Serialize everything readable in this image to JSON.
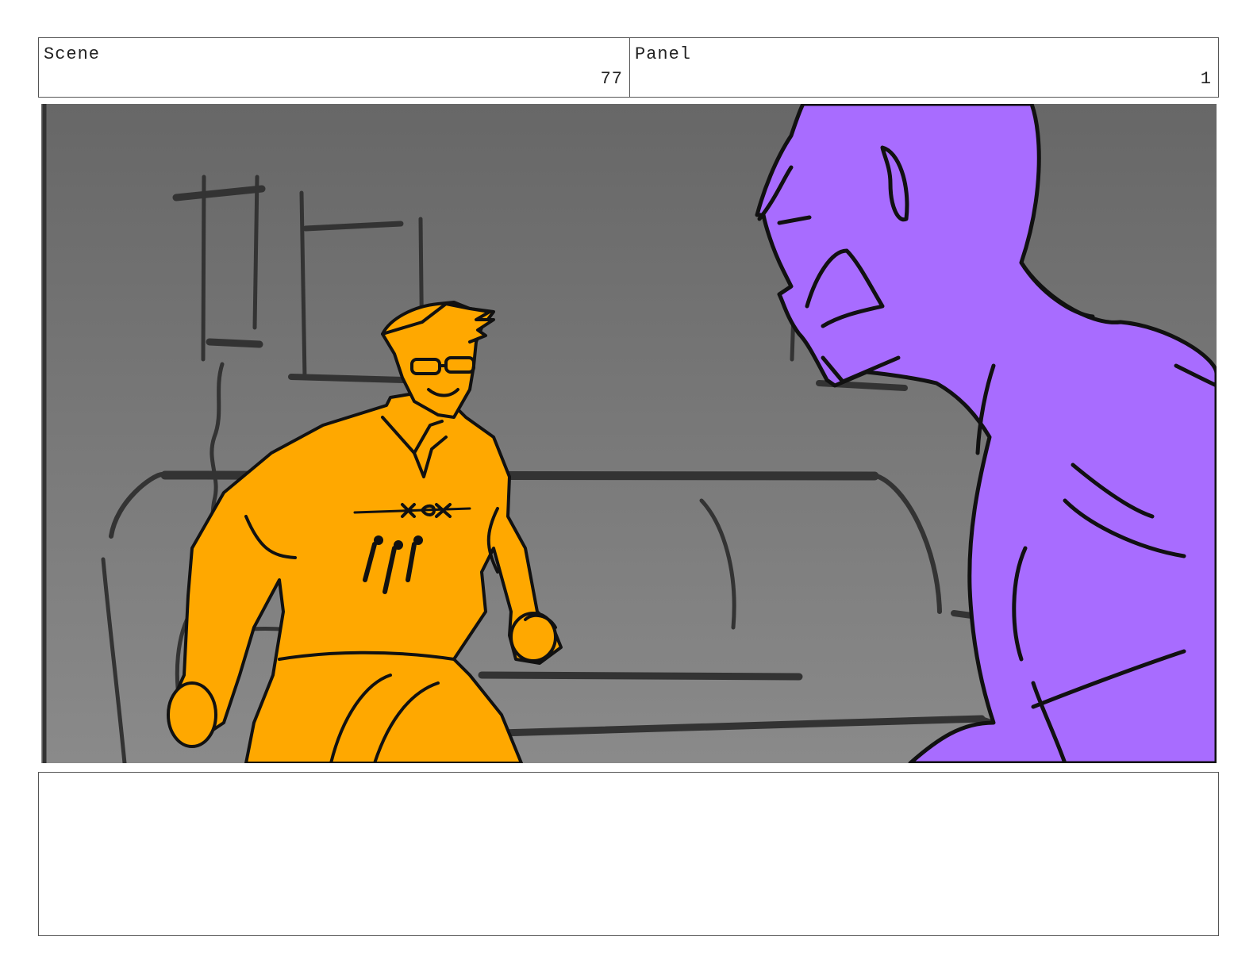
{
  "header": {
    "scene_label": "Scene",
    "scene_number": "77",
    "panel_label": "Panel",
    "panel_number": "1"
  },
  "colors": {
    "background_top": "#676767",
    "background_bottom": "#8a8a8a",
    "character_left_fill": "#ffa800",
    "character_right_fill": "#a86cff",
    "line": "#111111"
  },
  "notes": {
    "text": ""
  }
}
